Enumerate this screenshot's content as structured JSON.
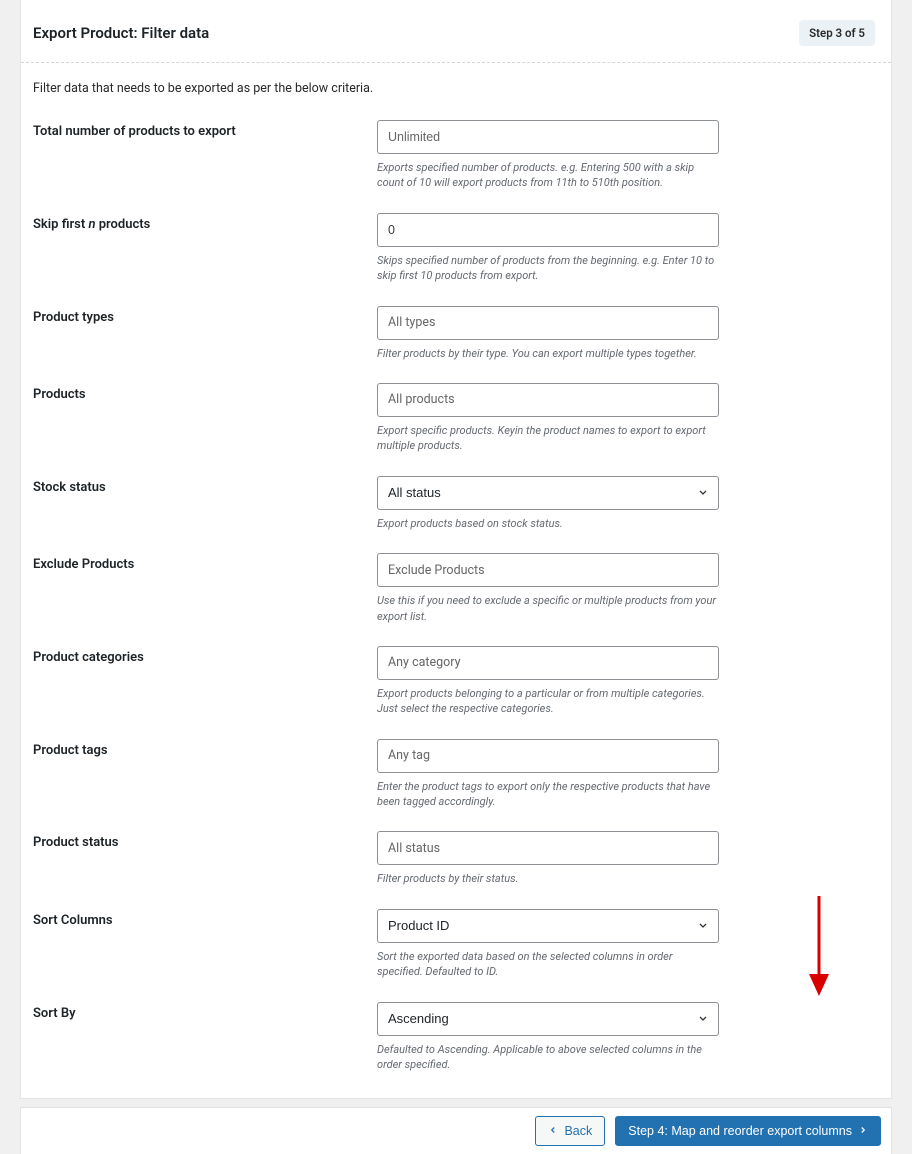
{
  "header": {
    "title": "Export Product: Filter data",
    "step_badge": "Step 3 of 5"
  },
  "intro": "Filter data that needs to be exported as per the below criteria.",
  "fields": {
    "total": {
      "label": "Total number of products to export",
      "placeholder": "Unlimited",
      "desc": "Exports specified number of products. e.g. Entering 500 with a skip count of 10 will export products from 11th to 510th position."
    },
    "skip": {
      "label_pre": "Skip first ",
      "label_em": "n",
      "label_post": " products",
      "value": "0",
      "desc": "Skips specified number of products from the beginning. e.g. Enter 10 to skip first 10 products from export."
    },
    "types": {
      "label": "Product types",
      "placeholder": "All types",
      "desc": "Filter products by their type. You can export multiple types together."
    },
    "products": {
      "label": "Products",
      "placeholder": "All products",
      "desc": "Export specific products. Keyin the product names to export to export multiple products."
    },
    "stock": {
      "label": "Stock status",
      "value": "All status",
      "desc": "Export products based on stock status."
    },
    "exclude": {
      "label": "Exclude Products",
      "placeholder": "Exclude Products",
      "desc": "Use this if you need to exclude a specific or multiple products from your export list."
    },
    "categories": {
      "label": "Product categories",
      "placeholder": "Any category",
      "desc": "Export products belonging to a particular or from multiple categories. Just select the respective categories."
    },
    "tags": {
      "label": "Product tags",
      "placeholder": "Any tag",
      "desc": "Enter the product tags to export only the respective products that have been tagged accordingly."
    },
    "status": {
      "label": "Product status",
      "placeholder": "All status",
      "desc": "Filter products by their status."
    },
    "sort_columns": {
      "label": "Sort Columns",
      "value": "Product ID",
      "desc": "Sort the exported data based on the selected columns in order specified. Defaulted to ID."
    },
    "sort_by": {
      "label": "Sort By",
      "value": "Ascending",
      "desc": "Defaulted to Ascending. Applicable to above selected columns in the order specified."
    }
  },
  "footer": {
    "back": "Back",
    "next": "Step 4: Map and reorder export columns"
  }
}
